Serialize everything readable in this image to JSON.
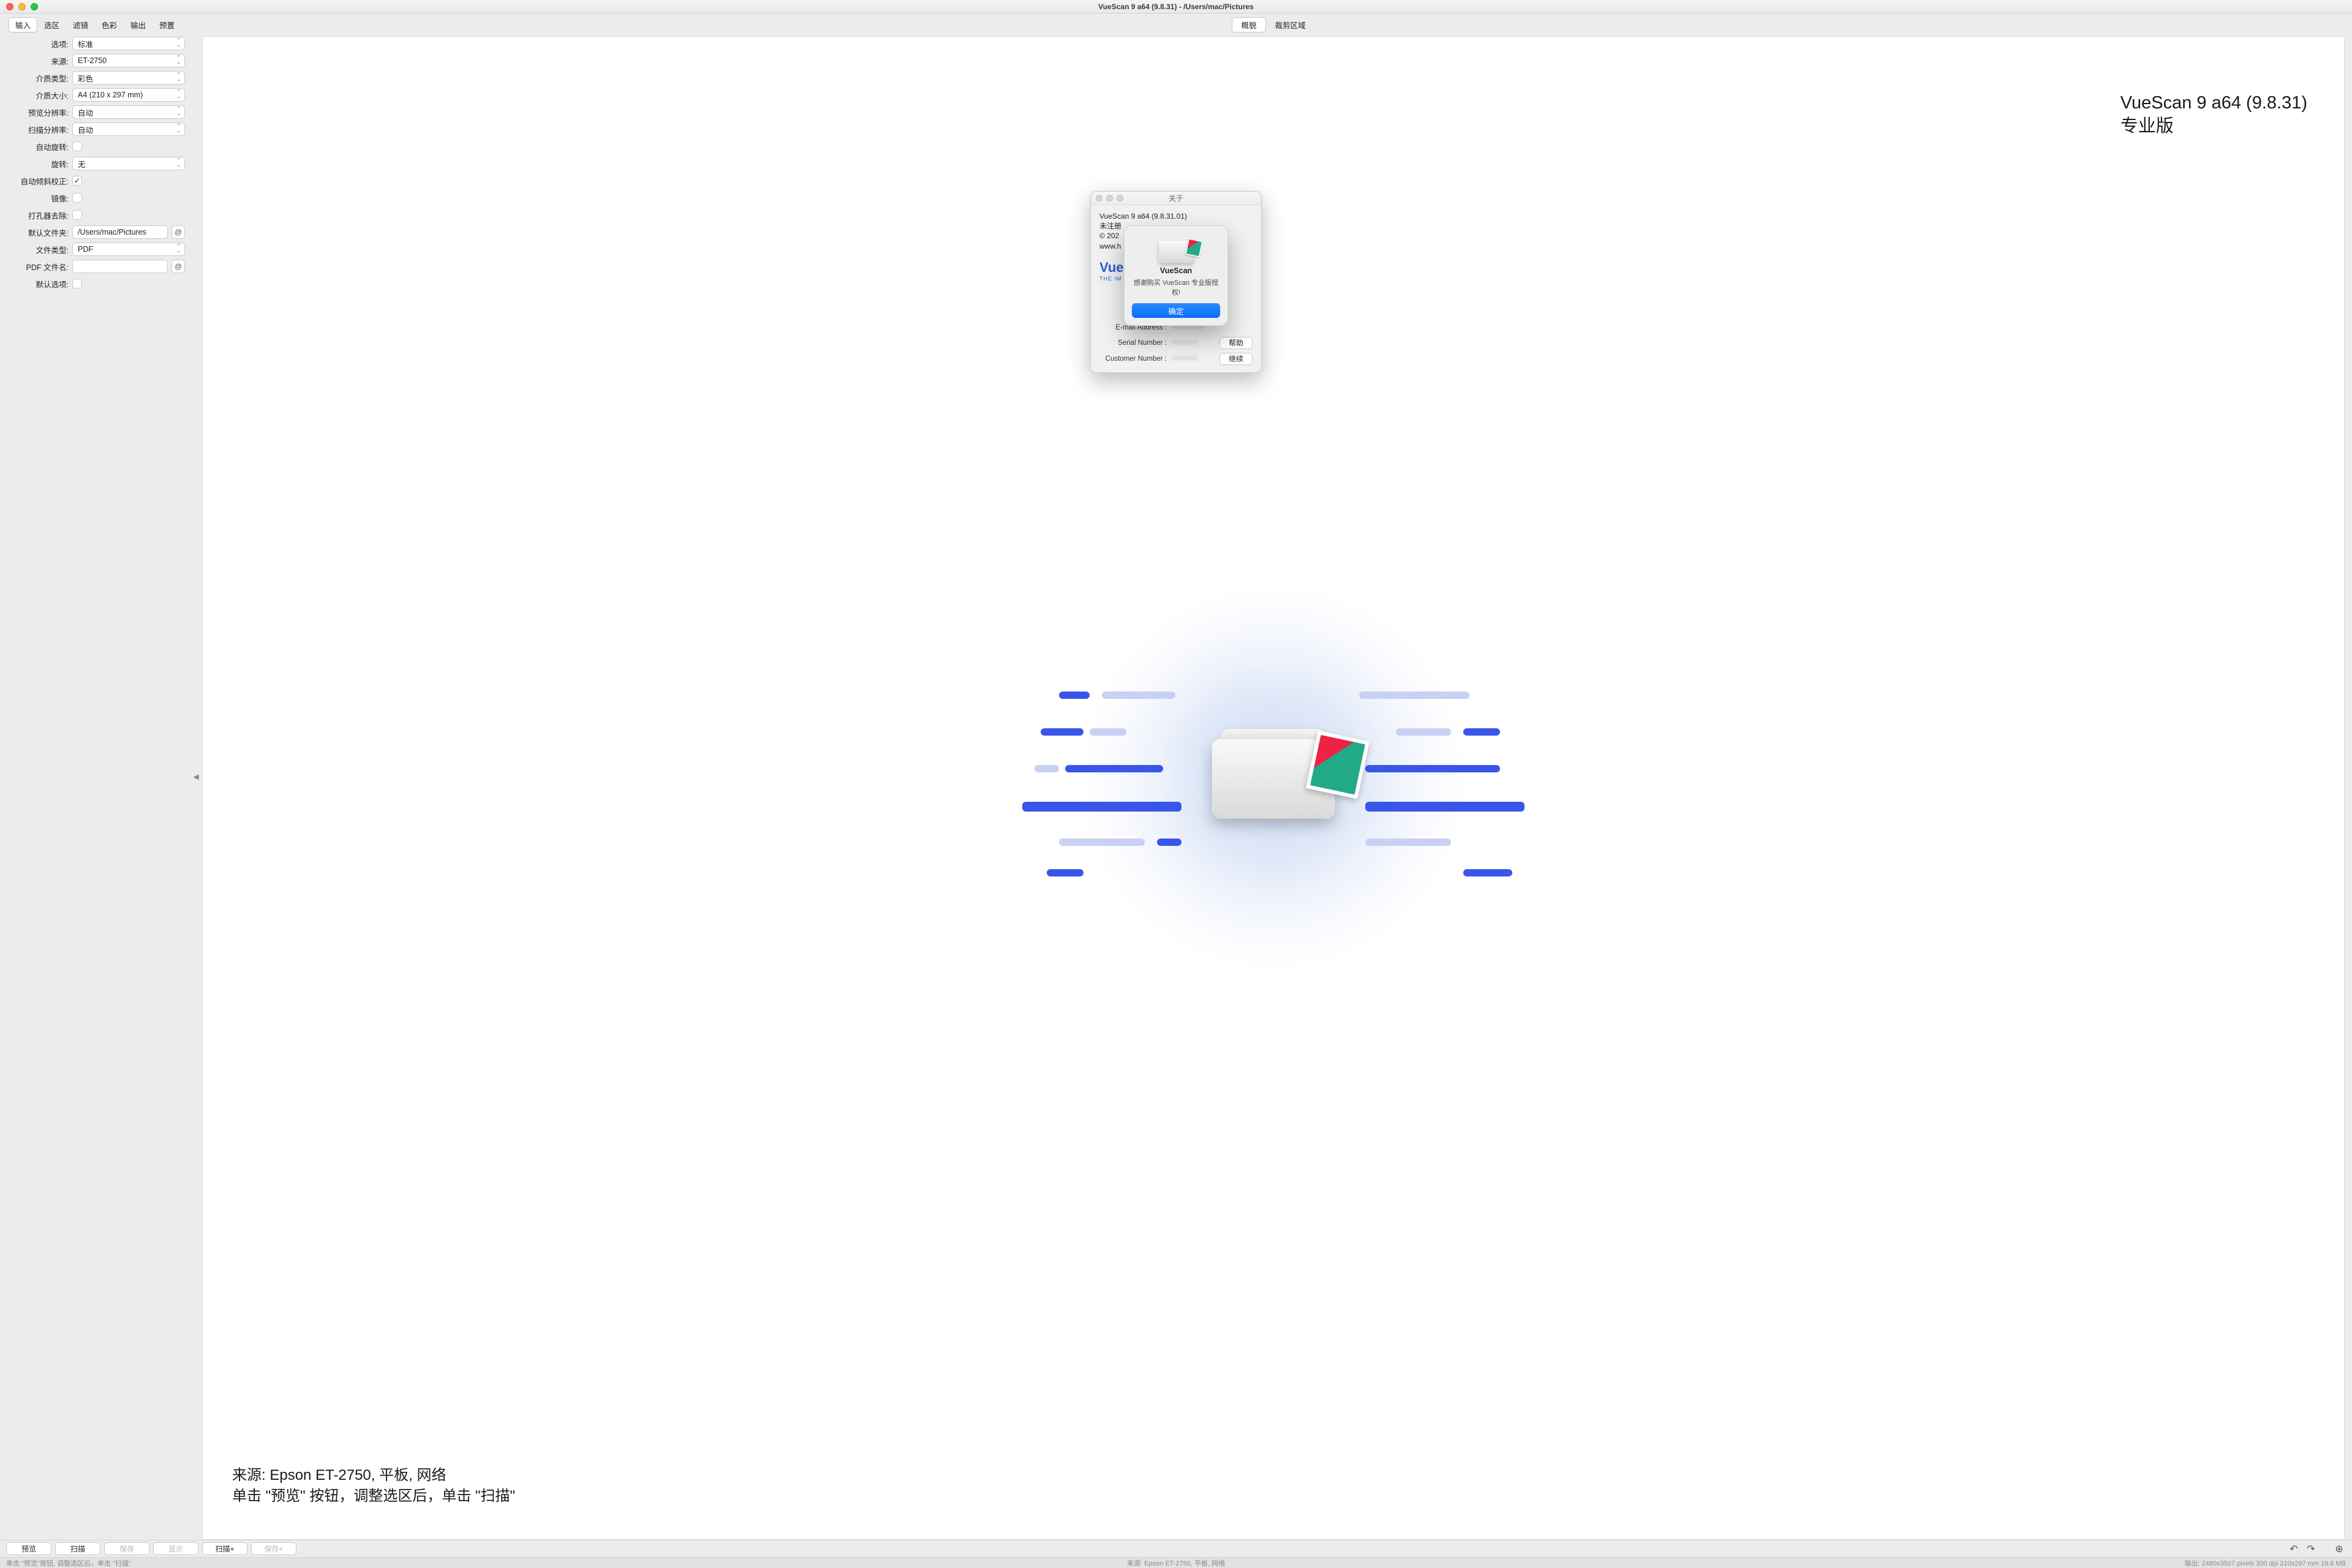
{
  "window": {
    "title": "VueScan 9 a64 (9.8.31) - /Users/mac/Pictures"
  },
  "sidebar": {
    "tabs": [
      "输入",
      "选区",
      "滤镜",
      "色彩",
      "输出",
      "预置"
    ],
    "active_tab": 0,
    "labels": {
      "options": "选项:",
      "source": "来源:",
      "media_type": "介质类型:",
      "media_size": "介质大小:",
      "preview_res": "预览分辨率:",
      "scan_res": "扫描分辨率:",
      "auto_rotate": "自动旋转:",
      "rotate": "旋转:",
      "auto_deskew": "自动倾斜校正:",
      "mirror": "镜像:",
      "punch_remove": "打孔器去除:",
      "default_folder": "默认文件夹:",
      "file_type": "文件类型:",
      "pdf_name": "PDF 文件名:",
      "default_opts": "默认选项:"
    },
    "values": {
      "options": "标准",
      "source": "ET-2750",
      "media_type": "彩色",
      "media_size": "A4 (210 x 297 mm)",
      "preview_res": "自动",
      "scan_res": "自动",
      "rotate": "无",
      "default_folder": "/Users/mac/Pictures",
      "file_type": "PDF",
      "pdf_name": ""
    },
    "checks": {
      "auto_rotate": false,
      "auto_deskew": true,
      "mirror": false,
      "punch_remove": false,
      "default_opts": false
    }
  },
  "preview": {
    "tabs": [
      "概貌",
      "裁剪区域"
    ],
    "active_tab": 0,
    "hero_title_line1": "VueScan 9 a64 (9.8.31)",
    "hero_title_line2": "专业版",
    "hero_source": "来源: Epson ET-2750, 平板, 网络",
    "hero_hint": "单击 \"预览\" 按钮，调整选区后，单击 \"扫描\""
  },
  "bottom": {
    "preview": "预览",
    "scan": "扫描",
    "save": "保存",
    "show": "显示",
    "scan_plus": "扫描+",
    "save_plus": "保存+"
  },
  "status": {
    "left": "单击 \"预览\"按钮, 调整选区后，单击 \"扫描\"",
    "mid": "来源: Epson ET-2750, 平板, 网络",
    "right": "输出: 2480x3507 pixels 300 dpi 210x297 mm 19.6 MB"
  },
  "about": {
    "title": "关于",
    "lines": [
      "VueScan 9 a64 (9.8.31.01)",
      "未注册",
      "© 202",
      "www.h"
    ],
    "brand": "VueScan",
    "brand_sub": "THE IM",
    "email_label": "E-mail Address :",
    "serial_label": "Serial Number :",
    "customer_label": "Customer Number :",
    "help": "帮助",
    "continue": "继续"
  },
  "alert": {
    "appname": "VueScan",
    "msg": "感谢购买 VueScan 专业版授权!",
    "ok": "确定"
  }
}
